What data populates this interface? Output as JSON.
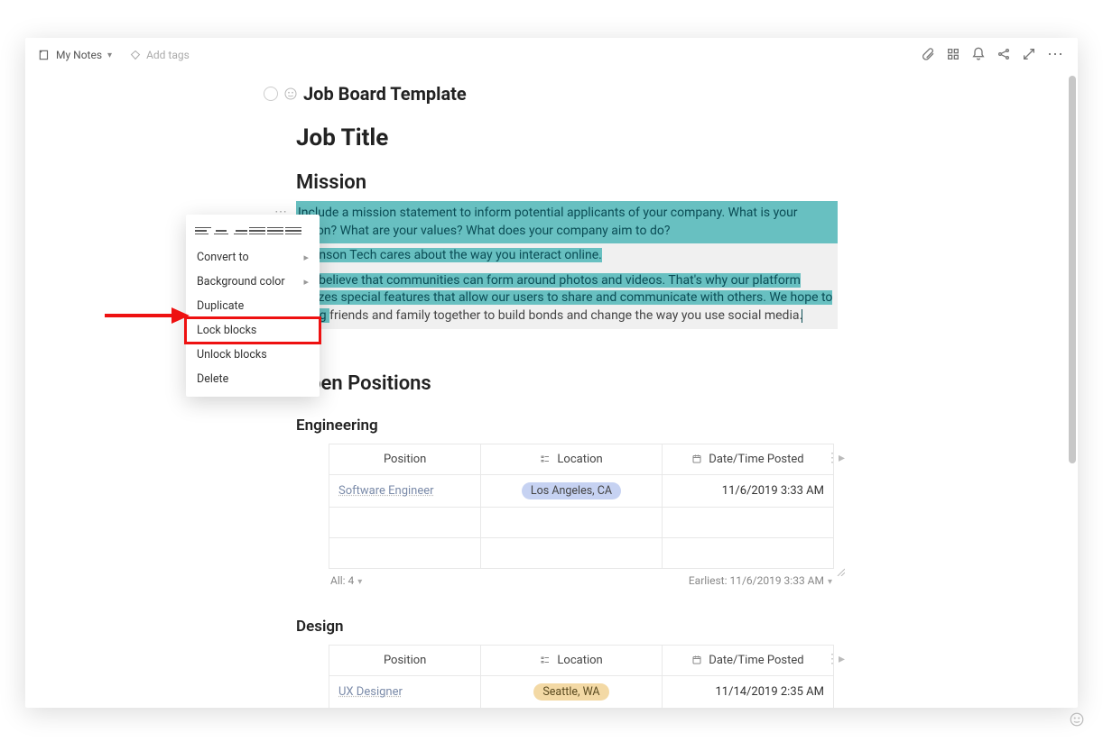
{
  "breadcrumb": {
    "label": "My Notes"
  },
  "tags": {
    "placeholder": "Add tags"
  },
  "page": {
    "title": "Job Board Template",
    "h2": "Job Title",
    "mission_heading": "Mission",
    "open_positions_heading": "Open Positions",
    "engineering_heading": "Engineering",
    "design_heading": "Design"
  },
  "mission": {
    "p1": "Include a mission statement to inform potential applicants of your company. What is your vision? What are your values? What does your company aim to do?",
    "p2": "Johnson Tech cares about the way you interact online.",
    "p3_hl": "We believe that communities can form around photos and videos. That's why our platform utilizes special features that allow our users to share and communicate with others. We hope to bring ",
    "p3_plain": "friends and family together to build bonds and change the way you use social media."
  },
  "context_menu": {
    "convert_to": "Convert to",
    "background_color": "Background color",
    "duplicate": "Duplicate",
    "lock_blocks": "Lock blocks",
    "unlock_blocks": "Unlock blocks",
    "delete": "Delete"
  },
  "tables": {
    "headers": {
      "position": "Position",
      "location": "Location",
      "datetime": "Date/Time Posted"
    },
    "engineering": {
      "rows": [
        {
          "position": "Software Engineer",
          "location": "Los Angeles, CA",
          "datetime": "11/6/2019 3:33 AM"
        },
        {
          "position": "",
          "location": "",
          "datetime": ""
        },
        {
          "position": "",
          "location": "",
          "datetime": ""
        }
      ],
      "footer_left": "All: 4",
      "footer_right": "Earliest: 11/6/2019 3:33 AM"
    },
    "design": {
      "rows": [
        {
          "position": "UX Designer",
          "location": "Seattle, WA",
          "datetime": "11/14/2019 2:35 AM"
        }
      ]
    }
  }
}
